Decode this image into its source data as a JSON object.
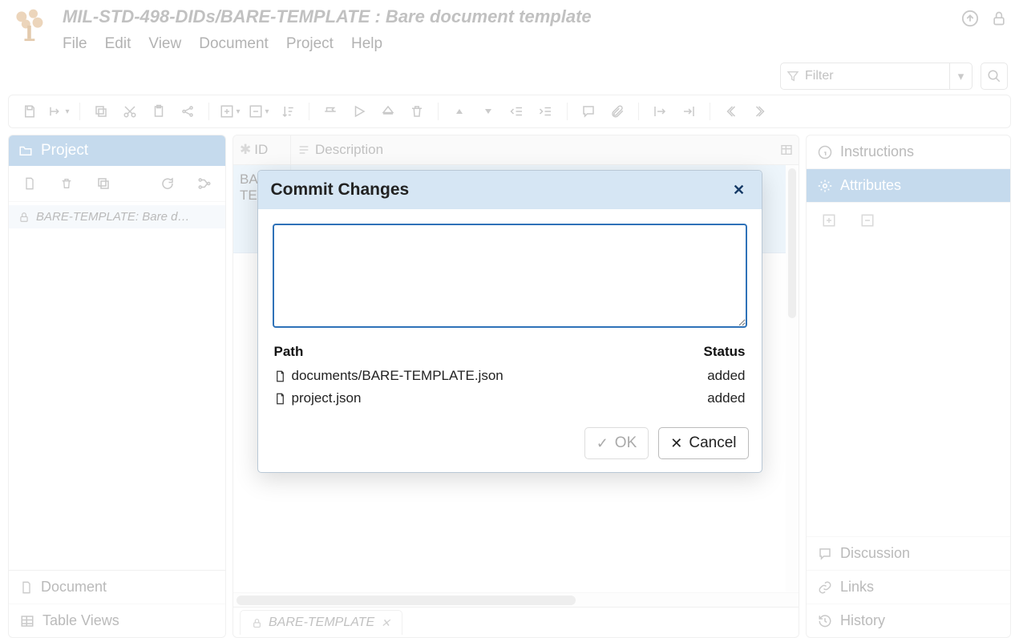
{
  "header": {
    "title": "MIL-STD-498-DIDs/BARE-TEMPLATE : Bare document template",
    "menu": {
      "file": "File",
      "edit": "Edit",
      "view": "View",
      "document": "Document",
      "project": "Project",
      "help": "Help"
    },
    "filter_placeholder": "Filter"
  },
  "left": {
    "panel_title": "Project",
    "tree_item": "BARE-TEMPLATE: Bare d…",
    "bottom": {
      "document": "Document",
      "table_views": "Table Views"
    }
  },
  "center": {
    "columns": {
      "id": "ID",
      "description": "Description"
    },
    "row": {
      "id": "BARE-TEM-1",
      "description": ""
    },
    "tab": "BARE-TEMPLATE"
  },
  "right": {
    "instructions": "Instructions",
    "attributes": "Attributes",
    "discussion": "Discussion",
    "links": "Links",
    "history": "History"
  },
  "dialog": {
    "title": "Commit Changes",
    "path_header": "Path",
    "status_header": "Status",
    "files": [
      {
        "path": "documents/BARE-TEMPLATE.json",
        "status": "added"
      },
      {
        "path": "project.json",
        "status": "added"
      }
    ],
    "ok": "OK",
    "cancel": "Cancel"
  }
}
